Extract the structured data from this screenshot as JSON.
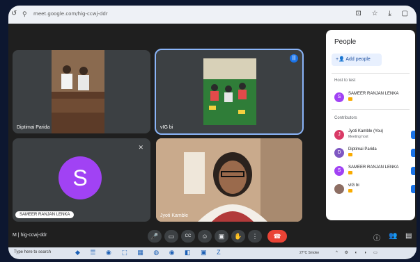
{
  "browser": {
    "url": "meet.google.com/hig-ccwj-ddr",
    "nav_glyph": "↺",
    "site_glyph": "⚲",
    "right_icons": "⊡ ☆ ⤓ ▢"
  },
  "tiles": [
    {
      "name": "Diptimai Parida",
      "type": "video"
    },
    {
      "name": "vIG bi",
      "type": "video",
      "speaking": true
    },
    {
      "name": "SAMEER RANJAN LENKA",
      "type": "avatar",
      "initial": "S",
      "muted": true
    },
    {
      "name": "Jyoti Kamble",
      "type": "video"
    }
  ],
  "panel": {
    "title": "People",
    "add_people": "Add people",
    "section_host": "Host to test",
    "section_contributors": "Contributors",
    "host": {
      "name": "SAMEER RANJAN LENKA",
      "initial": "S",
      "color": "#a142f4"
    },
    "contributors": [
      {
        "name": "Jyoti Kamble (You)",
        "sub": "Meeting host",
        "initial": "J",
        "color": "#d93a66"
      },
      {
        "name": "Diptimai Parida",
        "initial": "D",
        "color": "#7e57c2"
      },
      {
        "name": "SAMEER RANJAN LENKA",
        "initial": "S",
        "color": "#a142f4"
      },
      {
        "name": "vIG bi",
        "initial": "",
        "color": "#8d6e63"
      }
    ]
  },
  "controls": {
    "meeting_code": "M | hig-ccwj-ddr",
    "mic": "🎤",
    "camera": "▭",
    "captions": "CC",
    "emoji": "☺",
    "present": "▣",
    "hand": "✋",
    "more": "⋮",
    "end": "☎",
    "info": "ⓘ",
    "people": "👥",
    "chat": "▤"
  },
  "taskbar": {
    "search": "Type here to search",
    "apps": "◆ ☰ ◉ ⬚ ▦ ◍ ◉ ◧ ▣ Z",
    "weather": "27°C  Smoke",
    "tray": "^ ⚙ ◐ ◗ ▭"
  },
  "colors": {
    "accent": "#8ab4f8",
    "end_call": "#ea4335",
    "avatar": "#a142f4"
  }
}
